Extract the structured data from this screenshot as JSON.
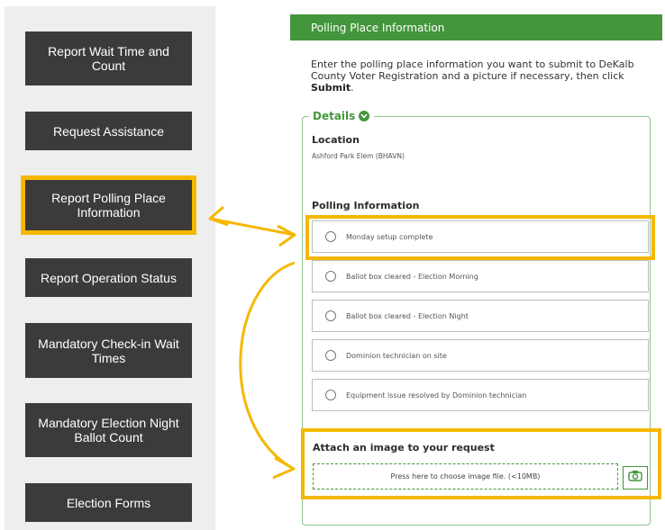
{
  "sidebar": {
    "items": [
      {
        "label": "Report Wait Time and Count",
        "highlighted": false
      },
      {
        "label": "Request Assistance",
        "highlighted": false
      },
      {
        "label": "Report Polling Place Information",
        "highlighted": true
      },
      {
        "label": "Report Operation Status",
        "highlighted": false
      },
      {
        "label": "Mandatory Check-in Wait Times",
        "highlighted": false
      },
      {
        "label": "Mandatory Election Night Ballot Count",
        "highlighted": false
      },
      {
        "label": "Election Forms",
        "highlighted": false
      }
    ]
  },
  "panel": {
    "title": "Polling Place Information",
    "intro_text": "Enter the polling place information you want to submit to DeKalb County Voter Registration and a picture if necessary, then click ",
    "intro_bold": "Submit",
    "intro_end": ".",
    "details_legend": "Details",
    "location_label": "Location",
    "location_value": "Ashford Park Elem (BHAVN)",
    "polling_label": "Polling Information",
    "options": [
      "Monday setup complete",
      "Ballot box cleared - Election Morning",
      "Ballot box cleared - Election Night",
      "Dominion technician on site",
      "Equipment issue resolved by Dominion technician"
    ],
    "attach_label": "Attach an image to your request",
    "dropzone_text": "Press here to choose image file. (<10MB)",
    "camera_icon": "camera-icon"
  },
  "colors": {
    "header_green": "#43963c",
    "button_dark": "#3d3b3a",
    "highlight_yellow": "#f5b800",
    "sidebar_bg": "#eeeeee"
  }
}
